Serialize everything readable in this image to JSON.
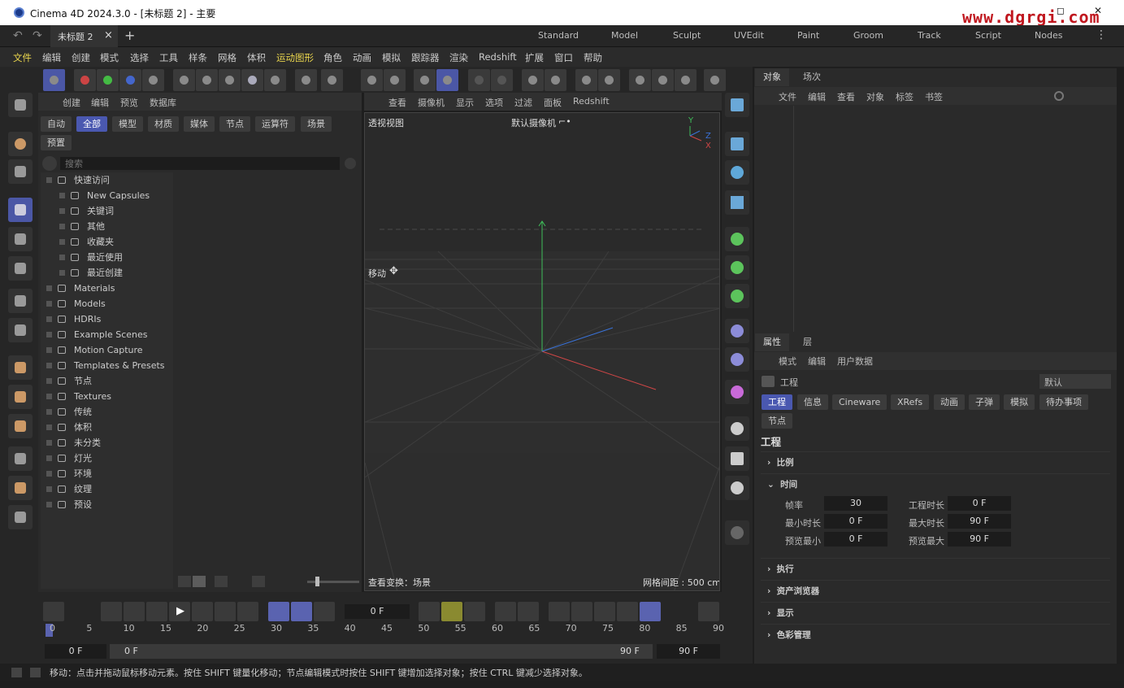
{
  "window": {
    "title": "Cinema 4D 2024.3.0 - [未标题 2] - 主要",
    "watermark": "www.dgrgi.com",
    "minimize": "—",
    "maximize": "◻",
    "close": "✕"
  },
  "tabs": {
    "doc_tab": "未标题 2",
    "close": "×",
    "add": "+",
    "layouts": [
      "Standard",
      "Model",
      "Sculpt",
      "UVEdit",
      "Paint",
      "Groom",
      "Track",
      "Script",
      "Nodes"
    ],
    "more": "⋮"
  },
  "menu": [
    "文件",
    "编辑",
    "创建",
    "模式",
    "选择",
    "工具",
    "样条",
    "网格",
    "体积",
    "运动图形",
    "角色",
    "动画",
    "模拟",
    "跟踪器",
    "渲染",
    "Redshift",
    "扩展",
    "窗口",
    "帮助"
  ],
  "asset_browser": {
    "menu": [
      "创建",
      "编辑",
      "预览",
      "数据库"
    ],
    "filters": [
      "自动",
      "全部",
      "模型",
      "材质",
      "媒体",
      "节点",
      "运算符",
      "场景",
      "预置"
    ],
    "search_placeholder": "搜索",
    "tree": [
      {
        "label": "快速访问",
        "indent": 0
      },
      {
        "label": "New Capsules",
        "indent": 1
      },
      {
        "label": "关键词",
        "indent": 1
      },
      {
        "label": "其他",
        "indent": 1
      },
      {
        "label": "收藏夹",
        "indent": 1
      },
      {
        "label": "最近使用",
        "indent": 1
      },
      {
        "label": "最近创建",
        "indent": 1
      },
      {
        "label": "Materials",
        "indent": 0
      },
      {
        "label": "Models",
        "indent": 0
      },
      {
        "label": "HDRIs",
        "indent": 0
      },
      {
        "label": "Example Scenes",
        "indent": 0
      },
      {
        "label": "Motion Capture",
        "indent": 0
      },
      {
        "label": "Templates & Presets",
        "indent": 0
      },
      {
        "label": "节点",
        "indent": 0
      },
      {
        "label": "Textures",
        "indent": 0
      },
      {
        "label": "传统",
        "indent": 0
      },
      {
        "label": "体积",
        "indent": 0
      },
      {
        "label": "未分类",
        "indent": 0
      },
      {
        "label": "灯光",
        "indent": 0
      },
      {
        "label": "环境",
        "indent": 0
      },
      {
        "label": "纹理",
        "indent": 0
      },
      {
        "label": "预设",
        "indent": 0
      }
    ]
  },
  "viewport": {
    "menu": [
      "查看",
      "摄像机",
      "显示",
      "选项",
      "过滤",
      "面板",
      "Redshift"
    ],
    "view_name": "透视视图",
    "camera": "默认摄像机",
    "camera_icon": "⌐•",
    "tool_label": "移动",
    "tool_icon": "✥",
    "bottom_left": "查看变换：场景",
    "bottom_right": "网格间距 : 500 cm",
    "axis_y": "Y",
    "axis_z": "Z",
    "axis_x": "X"
  },
  "object_panel": {
    "tabs": [
      "对象",
      "场次"
    ],
    "menu": [
      "文件",
      "编辑",
      "查看",
      "对象",
      "标签",
      "书签"
    ]
  },
  "attributes": {
    "tabs": [
      "属性",
      "层"
    ],
    "menu": [
      "模式",
      "编辑",
      "用户数据"
    ],
    "header": "工程",
    "preset": "默认",
    "subtabs": [
      "工程",
      "信息",
      "Cineware",
      "XRefs",
      "动画",
      "子弹",
      "模拟",
      "待办事项",
      "节点"
    ],
    "section_title": "工程",
    "sections": [
      {
        "label": "比例",
        "open": false
      },
      {
        "label": "时间",
        "open": true
      },
      {
        "label": "执行",
        "open": false
      },
      {
        "label": "资产浏览器",
        "open": false
      },
      {
        "label": "显示",
        "open": false
      },
      {
        "label": "色彩管理",
        "open": false
      }
    ],
    "time_fields": {
      "fps_label": "帧率",
      "fps": "30",
      "proj_len_label": "工程时长",
      "proj_len": "0 F",
      "min_label": "最小时长",
      "min": "0 F",
      "max_label": "最大时长",
      "max": "90 F",
      "pmin_label": "预览最小",
      "pmin": "0 F",
      "pmax_label": "预览最大",
      "pmax": "90 F"
    }
  },
  "timeline": {
    "current_frame": "0 F",
    "ticks": [
      "0",
      "5",
      "10",
      "15",
      "20",
      "25",
      "30",
      "35",
      "40",
      "45",
      "50",
      "55",
      "60",
      "65",
      "70",
      "75",
      "80",
      "85",
      "90"
    ],
    "range_start": "0 F",
    "range_start2": "0 F",
    "range_end": "90 F",
    "range_end2": "90 F"
  },
  "status": "移动：点击并拖动鼠标移动元素。按住 SHIFT 键量化移动；节点编辑模式时按住 SHIFT 键增加选择对象；按住 CTRL 键减少选择对象。",
  "colors": {
    "accent": "#4a58b0",
    "menu_highlight": "#e8d44d",
    "watermark": "#c0171f"
  }
}
